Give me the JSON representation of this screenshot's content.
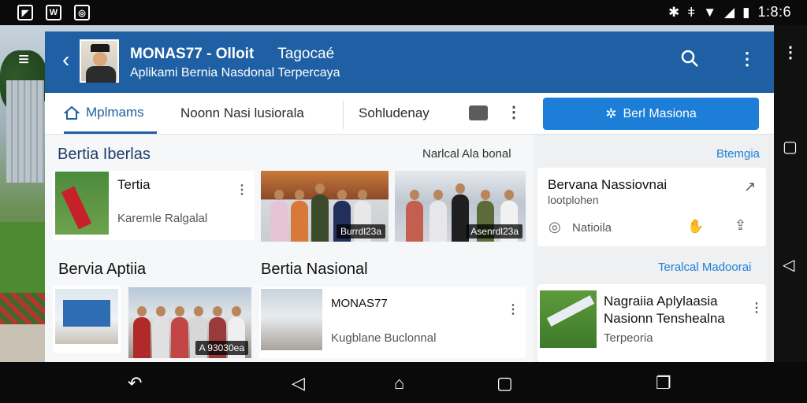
{
  "status_bar": {
    "time": "1:8:6"
  },
  "app": {
    "title": "MONAS77 - Olloit",
    "tagline": "Tagocaé",
    "subtitle": "Aplikami Bernia Nasdonal Terpercaya"
  },
  "tabs": [
    {
      "label": "Mplmams"
    },
    {
      "label": "Noonn Nasi lusiorala"
    },
    {
      "label": "Sohludenay"
    }
  ],
  "cta": {
    "label": "Berl Masiona"
  },
  "main": {
    "section1": {
      "title": "Bertia Iberlas",
      "right": "Narlcal Ala bonal"
    },
    "card1": {
      "title": "Tertia",
      "sub": "Karemle Ralgalal"
    },
    "photo1": {
      "badge": "Burrdl23a"
    },
    "photo2": {
      "badge": "Asenrdl23a"
    },
    "section2a": {
      "title": "Bervia Aptiia"
    },
    "section2b": {
      "title": "Bertia Nasional"
    },
    "photo3": {
      "badge": "A 93030ea"
    },
    "card2": {
      "title": "MONAS77",
      "sub": "Kugblane Buclonnal"
    }
  },
  "side": {
    "link1": "Btemgia",
    "card1": {
      "title": "Bervana Nassiovnai",
      "sub": "lootplohen",
      "meta": "Natioila"
    },
    "link2": "Teralcal Madoorai",
    "card2": {
      "title1": "Nagraiia Aplylaasia",
      "title2": "Nasionn Tenshealna",
      "sub": "Terpeoria"
    }
  }
}
